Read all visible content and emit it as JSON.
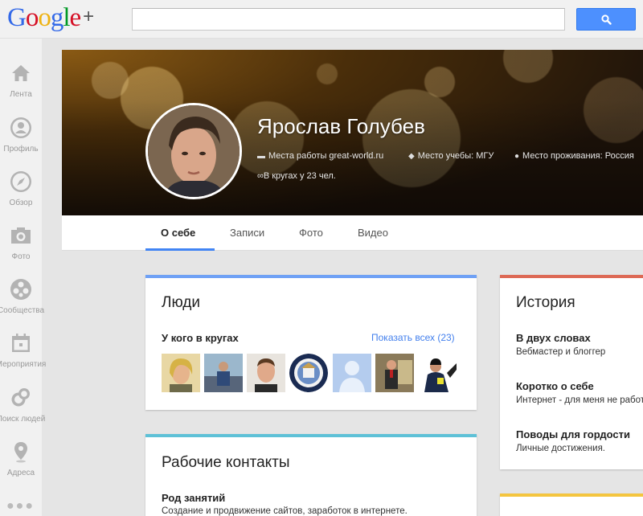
{
  "header": {
    "logo_letters": [
      "G",
      "o",
      "o",
      "g",
      "l",
      "e"
    ],
    "logo_colors": [
      "#3369e8",
      "#d50f25",
      "#eeb211",
      "#3369e8",
      "#009925",
      "#d50f25"
    ],
    "logo_plus": "+",
    "search": {
      "value": "",
      "placeholder": ""
    },
    "search_button_icon": "search-icon"
  },
  "sidebar": {
    "items": [
      {
        "label": "Лента",
        "icon": "home-icon"
      },
      {
        "label": "Профиль",
        "icon": "profile-icon"
      },
      {
        "label": "Обзор",
        "icon": "compass-icon"
      },
      {
        "label": "Фото",
        "icon": "camera-icon"
      },
      {
        "label": "Сообщества",
        "icon": "communities-icon"
      },
      {
        "label": "Мероприятия",
        "icon": "calendar-icon"
      },
      {
        "label": "Поиск людей",
        "icon": "find-people-icon"
      },
      {
        "label": "Адреса",
        "icon": "location-pin-icon"
      }
    ],
    "more": "●●●"
  },
  "profile": {
    "name": "Ярослав Голубев",
    "work": "Места работы great-world.ru",
    "education": "Место учебы: МГУ",
    "lives": "Место проживания: Россия",
    "circles": "В кругах у 23 чел."
  },
  "tabs": [
    {
      "label": "О себе",
      "active": true
    },
    {
      "label": "Записи"
    },
    {
      "label": "Фото"
    },
    {
      "label": "Видео"
    }
  ],
  "people_card": {
    "title": "Люди",
    "subtitle": "У кого в кругах",
    "show_all": "Показать всех (23)",
    "accent": "#6fa1f5"
  },
  "story_card": {
    "title": "История",
    "accent": "#dd6955",
    "sections": [
      {
        "heading": "В двух словах",
        "text": "Вебмастер и блоггер"
      },
      {
        "heading": "Коротко о себе",
        "text": "Интернет - для меня не работа"
      },
      {
        "heading": "Поводы для гордости",
        "text": "Личные достижения."
      }
    ]
  },
  "work_card": {
    "title": "Рабочие контакты",
    "accent": "#5ec1d7",
    "heading": "Род занятий",
    "text": "Создание и продвижение сайтов, заработок в интернете."
  },
  "next_card_accent": "#f4c53f"
}
